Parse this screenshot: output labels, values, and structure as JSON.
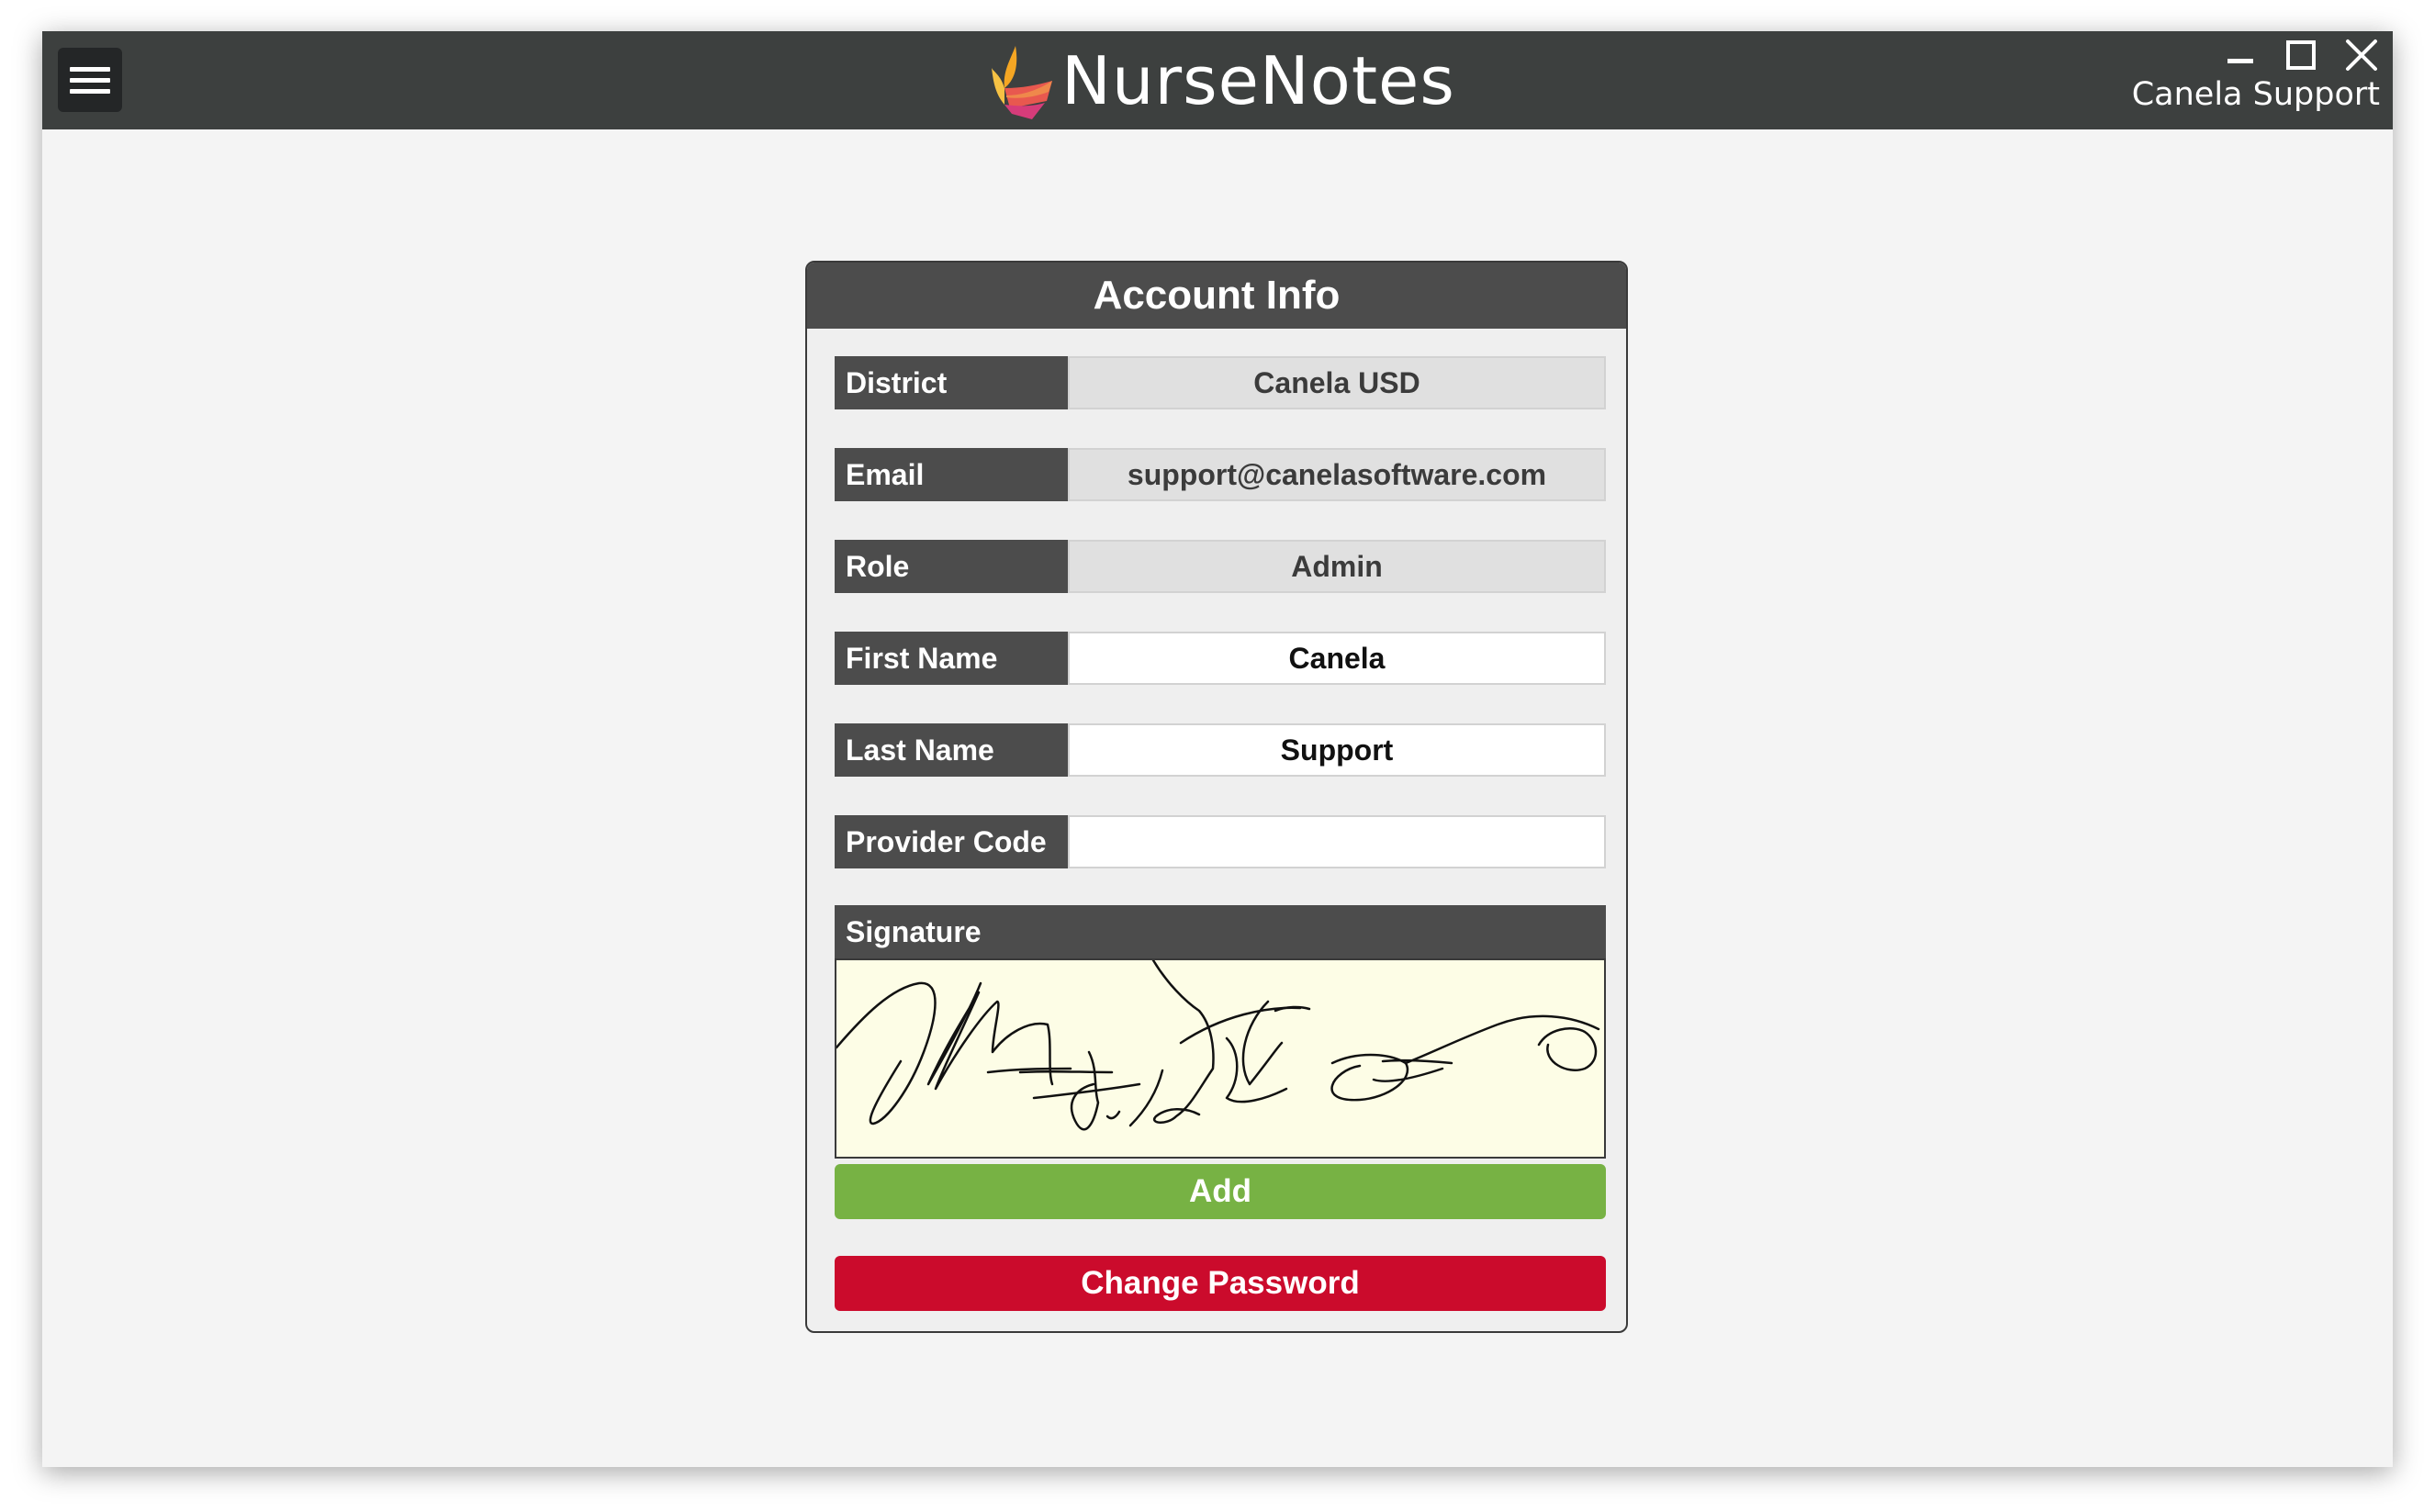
{
  "app": {
    "name": "NurseNotes",
    "user": "Canela Support"
  },
  "colors": {
    "titlebar": "#3d403f",
    "panel_header": "#4c4c4c",
    "add_button": "#77b244",
    "change_password_button": "#cb0b2c",
    "signature_background": "#fdfde6"
  },
  "icons": {
    "menu": "hamburger-icon",
    "minimize": "minimize-icon",
    "maximize": "maximize-icon",
    "close": "close-icon",
    "logo": "flame-logo"
  },
  "account": {
    "title": "Account Info",
    "fields": [
      {
        "label": "District",
        "value": "Canela USD",
        "editable": false
      },
      {
        "label": "Email",
        "value": "support@canelasoftware.com",
        "editable": false
      },
      {
        "label": "Role",
        "value": "Admin",
        "editable": false
      },
      {
        "label": "First Name",
        "value": "Canela",
        "editable": true
      },
      {
        "label": "Last Name",
        "value": "Support",
        "editable": true
      },
      {
        "label": "Provider Code",
        "value": "",
        "editable": true
      }
    ],
    "signature_label": "Signature",
    "add_label": "Add",
    "change_password_label": "Change Password"
  }
}
